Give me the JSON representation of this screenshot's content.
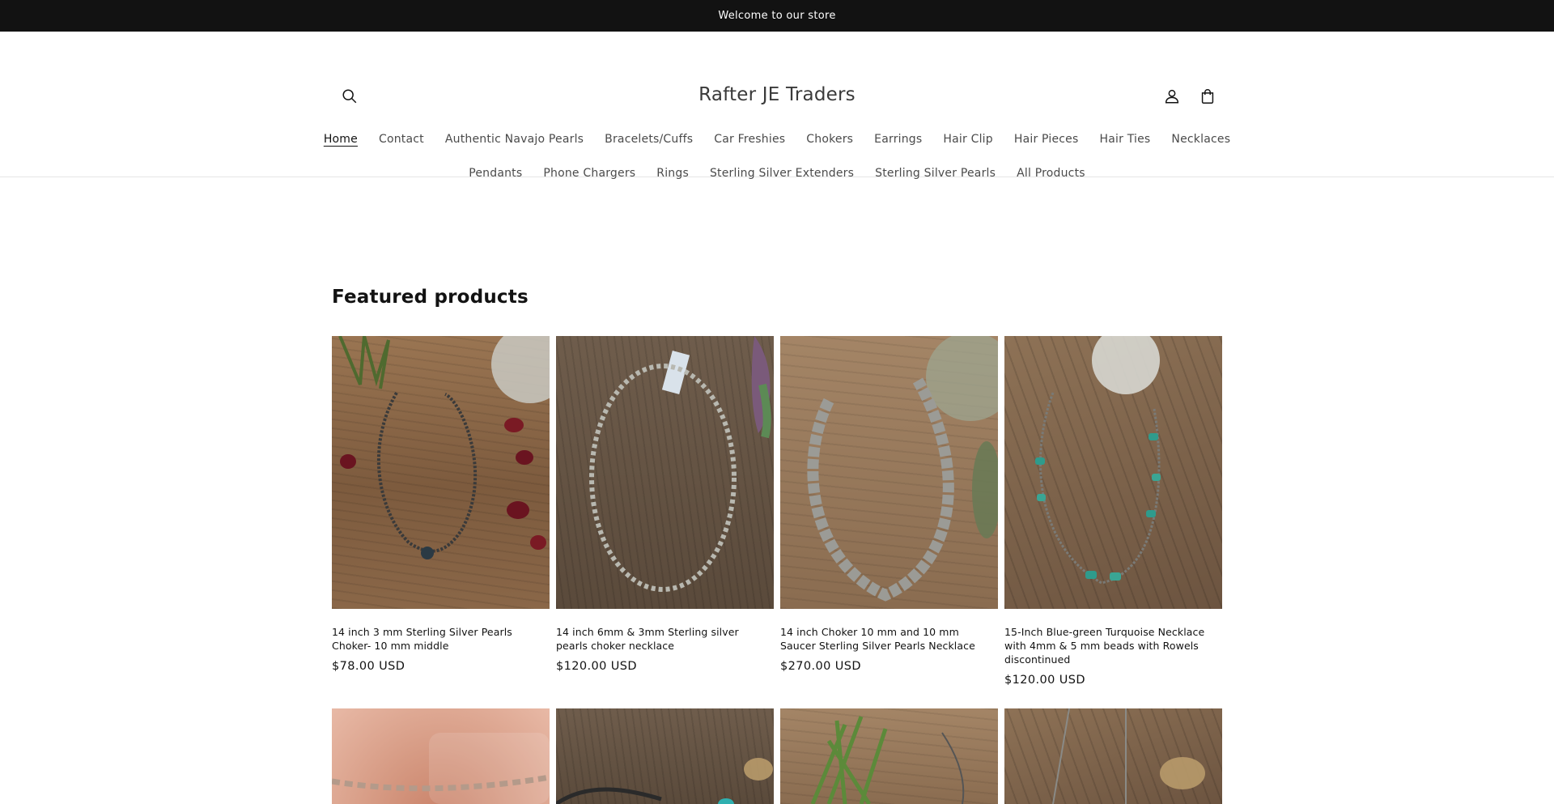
{
  "announcement": {
    "text": "Welcome to our store"
  },
  "header": {
    "logo": "Rafter JE Traders",
    "icons": {
      "search": "search-icon",
      "account": "account-icon",
      "cart": "cart-icon"
    }
  },
  "nav": {
    "row1": [
      "Home",
      "Contact",
      "Authentic Navajo Pearls",
      "Bracelets/Cuffs",
      "Car Freshies",
      "Chokers",
      "Earrings",
      "Hair Clip",
      "Hair Pieces",
      "Hair Ties",
      "Necklaces"
    ],
    "row2": [
      "Pendants",
      "Phone Chargers",
      "Rings",
      "Sterling Silver Extenders",
      "Sterling Silver Pearls",
      "All Products"
    ],
    "active": "Home"
  },
  "featured": {
    "title": "Featured products",
    "products": [
      {
        "title": "14 inch 3 mm Sterling Silver Pearls Choker- 10 mm middle",
        "price": "$78.00 USD"
      },
      {
        "title": "14 inch 6mm & 3mm Sterling silver pearls choker necklace",
        "price": "$120.00 USD"
      },
      {
        "title": "14 inch Choker 10 mm and 10 mm Saucer Sterling Silver Pearls Necklace",
        "price": "$270.00 USD"
      },
      {
        "title": "15-Inch Blue-green Turquoise Necklace with 4mm & 5 mm beads with Rowels discontinued",
        "price": "$120.00 USD"
      }
    ]
  },
  "colors": {
    "announcement_bg": "#121212",
    "text": "#121212",
    "border": "#e6e6e6"
  }
}
